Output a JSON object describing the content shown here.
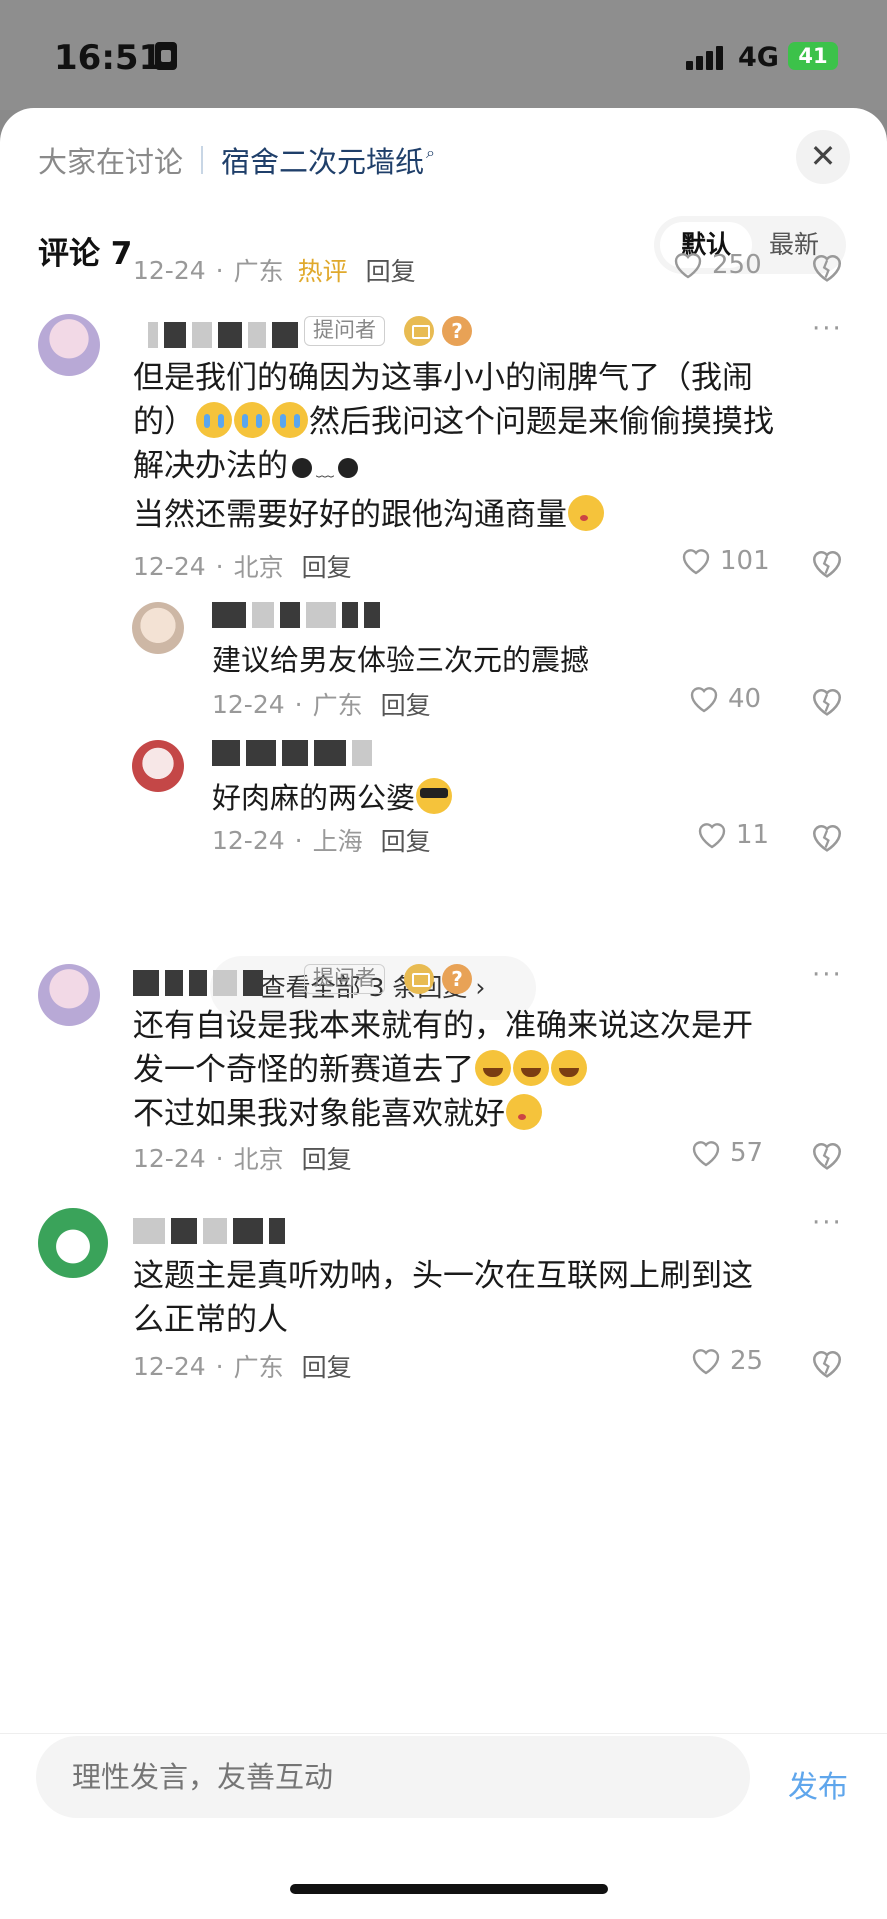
{
  "status": {
    "time": "16:51",
    "network": "4G",
    "battery": "41"
  },
  "header": {
    "label": "大家在讨论",
    "topic": "宿舍二次元墙纸",
    "close_icon": "close-icon"
  },
  "comments_header": {
    "title": "评论 7",
    "sort_default": "默认",
    "sort_newest": "最新"
  },
  "top_meta": {
    "date": "12-24",
    "region": "广东",
    "hot": "热评",
    "reply": "回复",
    "likes": "250"
  },
  "comments": [
    {
      "badge": "提问者",
      "line1": "但是我们的确因为这事小小的闹脾气了（我闹",
      "line2": "的）",
      "line2b": "然后我问这个问题是来偷偷摸摸找",
      "line3": "解决办法的",
      "line4": "当然还需要好好的跟他沟通商量",
      "date": "12-24",
      "region": "北京",
      "reply": "回复",
      "likes": "101",
      "replies": [
        {
          "text": "建议给男友体验三次元的震撼",
          "date": "12-24",
          "region": "广东",
          "reply": "回复",
          "likes": "40"
        },
        {
          "text": "好肉麻的两公婆",
          "date": "12-24",
          "region": "上海",
          "reply": "回复",
          "likes": "11"
        }
      ],
      "view_all": "查看全部 3 条回复 ›"
    },
    {
      "badge": "提问者",
      "line1": "还有自设是我本来就有的，准确来说这次是开",
      "line2": "发一个奇怪的新赛道去了",
      "line3": "不过如果我对象能喜欢就好",
      "date": "12-24",
      "region": "北京",
      "reply": "回复",
      "likes": "57"
    },
    {
      "line1": "这题主是真听劝呐，头一次在互联网上刷到这",
      "line2": "么正常的人",
      "date": "12-24",
      "region": "广东",
      "reply": "回复",
      "likes": "25"
    }
  ],
  "composer": {
    "placeholder": "理性发言，友善互动",
    "publish": "发布"
  },
  "colors": {
    "accent": "#5fa6ec",
    "hot": "#e0a92c",
    "topic": "#1f3f6a"
  }
}
